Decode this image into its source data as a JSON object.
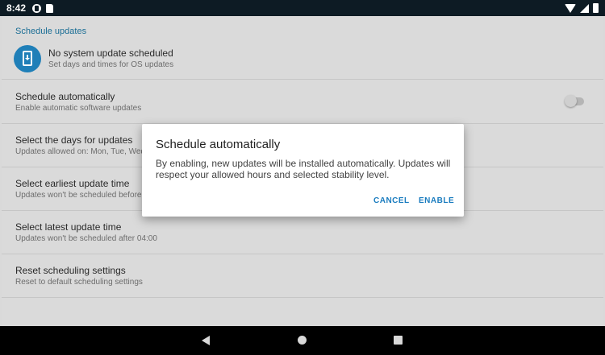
{
  "status_bar": {
    "time": "8:42"
  },
  "settings": {
    "section_header": "Schedule updates",
    "status_item": {
      "title": "No system update scheduled",
      "subtitle": "Set days and times for OS updates"
    },
    "rows": [
      {
        "title": "Schedule automatically",
        "subtitle": "Enable automatic software updates"
      },
      {
        "title": "Select the days for updates",
        "subtitle": "Updates allowed on: Mon, Tue, Wed"
      },
      {
        "title": "Select earliest update time",
        "subtitle": "Updates won't be scheduled before"
      },
      {
        "title": "Select latest update time",
        "subtitle": "Updates won't be scheduled after 04:00"
      },
      {
        "title": "Reset scheduling settings",
        "subtitle": "Reset to default scheduling settings"
      }
    ]
  },
  "dialog": {
    "title": "Schedule automatically",
    "body": "By enabling, new updates will be installed automatically. Updates will respect your allowed hours and selected stability level.",
    "cancel_label": "CANCEL",
    "enable_label": "ENABLE"
  },
  "colors": {
    "accent": "#1a7cbf",
    "status_bar": "#0d1b24",
    "scrim_background": "#d9d9d9",
    "dialog_background": "#ffffff"
  },
  "icons": {
    "status_item": "system-update-icon",
    "nav": [
      "back-icon",
      "home-icon",
      "recents-icon"
    ]
  }
}
